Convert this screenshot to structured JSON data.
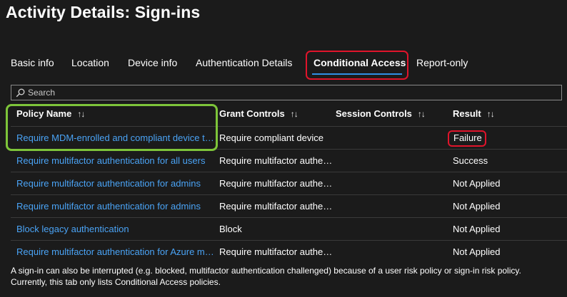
{
  "page": {
    "title": "Activity Details: Sign-ins"
  },
  "tabs": [
    {
      "label": "Basic info"
    },
    {
      "label": "Location"
    },
    {
      "label": "Device info"
    },
    {
      "label": "Authentication Details"
    },
    {
      "label": "Conditional Access",
      "active": true
    },
    {
      "label": "Report-only"
    }
  ],
  "search": {
    "placeholder": "Search"
  },
  "table": {
    "columns": [
      "Policy Name",
      "Grant Controls",
      "Session Controls",
      "Result"
    ],
    "sort_icon": "↑↓",
    "rows": [
      {
        "policy": "Require MDM-enrolled and compliant device to access cloud apps for all users",
        "grant": "Require compliant device",
        "session": "",
        "result": "Failure"
      },
      {
        "policy": "Require multifactor authentication for all users",
        "grant": "Require multifactor authentication",
        "session": "",
        "result": "Success"
      },
      {
        "policy": "Require multifactor authentication for admins",
        "grant": "Require multifactor authentication",
        "session": "",
        "result": "Not Applied"
      },
      {
        "policy": "Require multifactor authentication for admins",
        "grant": "Require multifactor authentication",
        "session": "",
        "result": "Not Applied"
      },
      {
        "policy": "Block legacy authentication",
        "grant": "Block",
        "session": "",
        "result": "Not Applied"
      },
      {
        "policy": "Require multifactor authentication for Azure management",
        "grant": "Require multifactor authentication",
        "session": "",
        "result": "Not Applied"
      }
    ]
  },
  "footnote": {
    "line1": "A sign-in can also be interrupted (e.g. blocked, multifactor authentication challenged) because of a user risk policy or sign-in risk policy.",
    "line2": "Currently, this tab only lists Conditional Access policies."
  },
  "colors": {
    "link": "#4aa3f5",
    "highlight_red": "#e0142b",
    "highlight_green": "#7ec53a",
    "active_tab": "#2f8fe6"
  }
}
